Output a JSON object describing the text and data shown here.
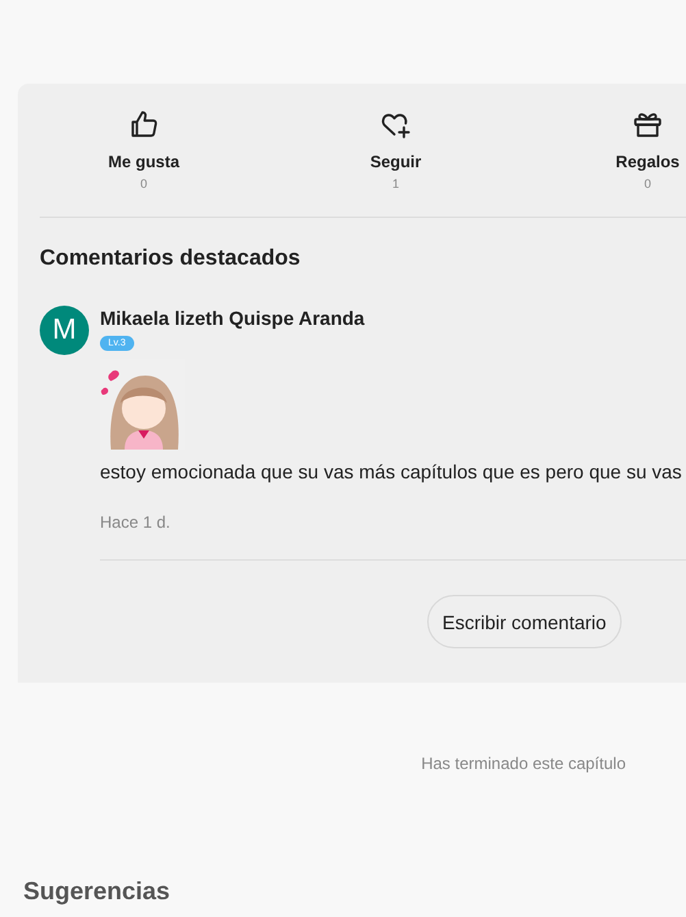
{
  "actions": [
    {
      "kind": "like",
      "label": "Me gusta",
      "count": "0"
    },
    {
      "kind": "follow",
      "label": "Seguir",
      "count": "1"
    },
    {
      "kind": "gift",
      "label": "Regalos",
      "count": "0"
    }
  ],
  "featured_comments": {
    "title": "Comentarios destacados",
    "comments": [
      {
        "avatar_letter": "M",
        "author": "Mikaela lizeth Quispe Aranda",
        "level_badge": "Lv.3",
        "text": "estoy emocionada que su vas más capítulos que es pero que su vas",
        "time": "Hace 1 d."
      }
    ],
    "write_button": "Escribir comentario"
  },
  "chapter_end_note": "Has terminado este capítulo",
  "suggestions_title": "Sugerencias"
}
